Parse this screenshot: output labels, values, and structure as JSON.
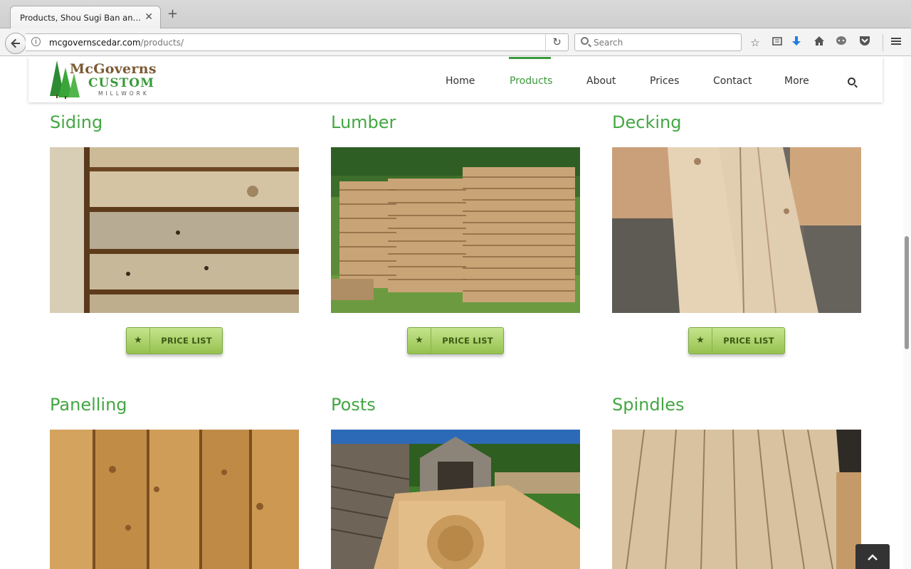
{
  "browser": {
    "tab_title": "Products, Shou Sugi Ban and ...",
    "tab_close": "✕",
    "new_tab": "+",
    "url_domain": "mcgovernscedar.com",
    "url_path": "/products/",
    "search_placeholder": "Search",
    "toolbar_icons": [
      "star-icon",
      "reading-list-icon",
      "download-icon",
      "home-icon",
      "chat-icon",
      "pocket-icon",
      "menu-icon"
    ]
  },
  "site": {
    "logo": {
      "line1": "McGoverns",
      "line2": "CUSTOM",
      "line3": "MILLWORK"
    },
    "nav": [
      "Home",
      "Products",
      "About",
      "Prices",
      "Contact",
      "More"
    ],
    "active_nav": "Products"
  },
  "products": [
    {
      "title": "Siding",
      "button": "PRICE LIST"
    },
    {
      "title": "Lumber",
      "button": "PRICE LIST"
    },
    {
      "title": "Decking",
      "button": "PRICE LIST"
    },
    {
      "title": "Panelling"
    },
    {
      "title": "Posts"
    },
    {
      "title": "Spindles"
    }
  ],
  "colors": {
    "accent": "#43a743",
    "button_green": "#a9d165",
    "logo_brown": "#7b5a33"
  }
}
